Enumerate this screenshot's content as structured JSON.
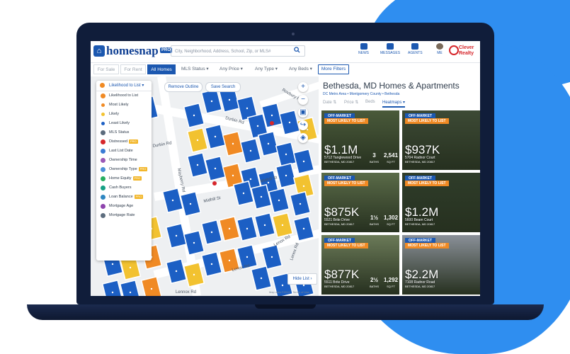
{
  "header": {
    "logo_text": "homesnap",
    "pro_badge": "PRO",
    "search_placeholder": "City, Neighborhood, Address, School, Zip, or MLS#",
    "nav": [
      "NEWS",
      "MESSAGES",
      "AGENTS",
      "ME"
    ],
    "brand": "Clever Realty"
  },
  "filters": {
    "tabs": [
      "For Sale",
      "For Rent",
      "All Homes"
    ],
    "active_tab": "All Homes",
    "dropdowns": [
      "MLS Status",
      "Any Price",
      "Any Type",
      "Any Beds"
    ],
    "more": "More Filters"
  },
  "map": {
    "panel_title": "Likelihood to List",
    "panel_items": [
      {
        "label": "Likelihood to List",
        "color": "#f08a24",
        "badge": ""
      },
      {
        "label": "Most Likely",
        "color": "#f08a24",
        "badge": "",
        "sub": true
      },
      {
        "label": "Likely",
        "color": "#f2c230",
        "badge": "",
        "sub": true
      },
      {
        "label": "Least Likely",
        "color": "#1c5fc4",
        "badge": "",
        "sub": true
      },
      {
        "label": "MLS Status",
        "color": "#5b6b7c",
        "badge": ""
      },
      {
        "label": "Distressed",
        "color": "#d6262b",
        "badge": "PRO"
      },
      {
        "label": "Last List Date",
        "color": "#3a7bd5",
        "badge": ""
      },
      {
        "label": "Ownership Time",
        "color": "#9b59b6",
        "badge": ""
      },
      {
        "label": "Ownership Type",
        "color": "#4a90d9",
        "badge": "PRO"
      },
      {
        "label": "Home Equity",
        "color": "#27ae60",
        "badge": "PRO"
      },
      {
        "label": "Cash Buyers",
        "color": "#16a085",
        "badge": ""
      },
      {
        "label": "Loan Balance",
        "color": "#2e86c1",
        "badge": "PRO"
      },
      {
        "label": "Mortgage Age",
        "color": "#8e44ad",
        "badge": ""
      },
      {
        "label": "Mortgage Rate",
        "color": "#5d6d7e",
        "badge": ""
      }
    ],
    "remove_outline": "Remove Outline",
    "save_search": "Save Search",
    "hide_list": "Hide List",
    "footer": "Map data ©2019 · Terms of Use",
    "streets": [
      "Durbin Rd",
      "Durbin Rd",
      "Midhill St",
      "Midhill St",
      "Lenox Rd",
      "Lenox Rd",
      "Mayberry Rd",
      "Roxbury Rd",
      "Lennox Rd",
      "Lenox Rd"
    ]
  },
  "listings": {
    "title": "Bethesda, MD Homes & Apartments",
    "breadcrumb": "DC Metro Area  •  Montgomery County  •  Bethesda",
    "sorts": [
      "Date",
      "Price",
      "Beds",
      "Heatmaps"
    ],
    "active_sort": "Heatmaps",
    "cards": [
      {
        "badge1": "OFF-MARKET",
        "badge2": "MOST LIKELY TO LIST",
        "price": "$1.1M",
        "addr": "5712 Tanglewood Drive",
        "city": "BETHESDA, MD 20817",
        "baths": "3",
        "sqft": "2,541",
        "bg": "#4a5a3a"
      },
      {
        "badge1": "OFF-MARKET",
        "badge2": "MOST LIKELY TO LIST",
        "price": "$937K",
        "addr": "5704 Radnor Court",
        "city": "BETHESDA, MD 20817",
        "baths": "",
        "sqft": "",
        "bg": "#3d4a35"
      },
      {
        "badge1": "OFF-MARKET",
        "badge2": "MOST LIKELY TO LIST",
        "price": "$875K",
        "addr": "5521 Brite Drive",
        "city": "BETHESDA, MD 20817",
        "baths": "1½",
        "sqft": "1,302",
        "bg": "#5a6b48"
      },
      {
        "badge1": "OFF-MARKET",
        "badge2": "MOST LIKELY TO LIST",
        "price": "$1.2M",
        "addr": "5600 Beam Court",
        "city": "BETHESDA, MD 20817",
        "baths": "",
        "sqft": "",
        "bg": "#2f3d2a"
      },
      {
        "badge1": "OFF-MARKET",
        "badge2": "MOST LIKELY TO LIST",
        "price": "$877K",
        "addr": "5511 Brite Drive",
        "city": "BETHESDA, MD 20817",
        "baths": "2½",
        "sqft": "1,292",
        "bg": "#6b7a58"
      },
      {
        "badge1": "OFF-MARKET",
        "badge2": "MOST LIKELY TO LIST",
        "price": "$2.2M",
        "addr": "7108 Radnor Road",
        "city": "BETHESDA, MD 20817",
        "baths": "",
        "sqft": "",
        "bg": "#8a9098"
      }
    ],
    "baths_label": "BATHS",
    "sqft_label": "SQ FT"
  },
  "colors": {
    "brand_blue": "#1c58b0",
    "parcel_blue": "#1c5fc4",
    "orange": "#f08a24",
    "yellow": "#f2c230",
    "bg_blue": "#2f8ef0"
  }
}
